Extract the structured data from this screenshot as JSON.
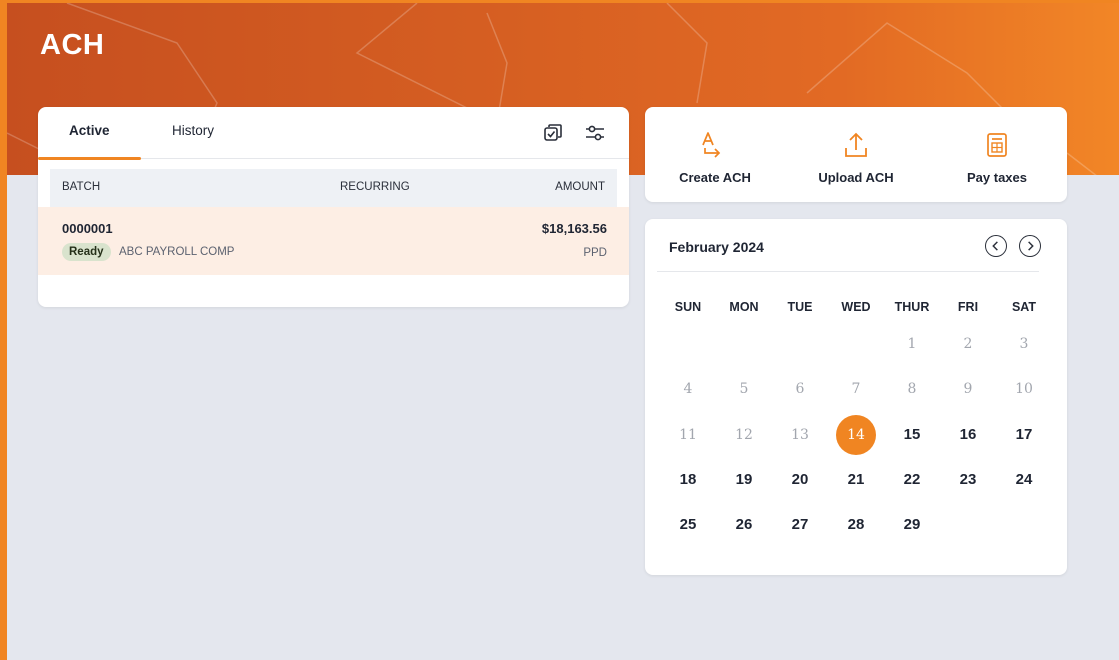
{
  "page": {
    "title": "ACH"
  },
  "colors": {
    "accent": "#f08522",
    "row_highlight": "#fdeee4",
    "badge_bg": "#d9e3cd"
  },
  "batches": {
    "tabs": [
      {
        "label": "Active",
        "active": true
      },
      {
        "label": "History",
        "active": false
      }
    ],
    "tools": {
      "select_icon": "checkbox-select-icon",
      "filter_icon": "sliders-filter-icon"
    },
    "columns": {
      "batch": "BATCH",
      "recurring": "RECURRING",
      "amount": "AMOUNT"
    },
    "rows": [
      {
        "id": "0000001",
        "status": "Ready",
        "company": "ABC PAYROLL COMP",
        "recurring": "",
        "amount": "$18,163.56",
        "type": "PPD"
      }
    ]
  },
  "actions": [
    {
      "label": "Create ACH",
      "icon": "create-ach-icon"
    },
    {
      "label": "Upload ACH",
      "icon": "upload-icon"
    },
    {
      "label": "Pay taxes",
      "icon": "tax-calculator-icon"
    }
  ],
  "calendar": {
    "month_label": "February 2024",
    "weekdays": [
      "SUN",
      "MON",
      "TUE",
      "WED",
      "THUR",
      "FRI",
      "SAT"
    ],
    "weeks": [
      [
        null,
        null,
        null,
        null,
        {
          "d": "1",
          "s": "disabled"
        },
        {
          "d": "2",
          "s": "disabled"
        },
        {
          "d": "3",
          "s": "disabled"
        }
      ],
      [
        {
          "d": "4",
          "s": "disabled"
        },
        {
          "d": "5",
          "s": "disabled"
        },
        {
          "d": "6",
          "s": "disabled"
        },
        {
          "d": "7",
          "s": "disabled"
        },
        {
          "d": "8",
          "s": "disabled"
        },
        {
          "d": "9",
          "s": "disabled"
        },
        {
          "d": "10",
          "s": "disabled"
        }
      ],
      [
        {
          "d": "11",
          "s": "disabled"
        },
        {
          "d": "12",
          "s": "disabled"
        },
        {
          "d": "13",
          "s": "disabled"
        },
        {
          "d": "14",
          "s": "today"
        },
        {
          "d": "15",
          "s": "enabled"
        },
        {
          "d": "16",
          "s": "enabled"
        },
        {
          "d": "17",
          "s": "enabled"
        }
      ],
      [
        {
          "d": "18",
          "s": "enabled"
        },
        {
          "d": "19",
          "s": "enabled"
        },
        {
          "d": "20",
          "s": "enabled"
        },
        {
          "d": "21",
          "s": "enabled"
        },
        {
          "d": "22",
          "s": "enabled"
        },
        {
          "d": "23",
          "s": "enabled"
        },
        {
          "d": "24",
          "s": "enabled"
        }
      ],
      [
        {
          "d": "25",
          "s": "enabled"
        },
        {
          "d": "26",
          "s": "enabled"
        },
        {
          "d": "27",
          "s": "enabled"
        },
        {
          "d": "28",
          "s": "enabled"
        },
        {
          "d": "29",
          "s": "enabled"
        },
        null,
        null
      ]
    ]
  }
}
